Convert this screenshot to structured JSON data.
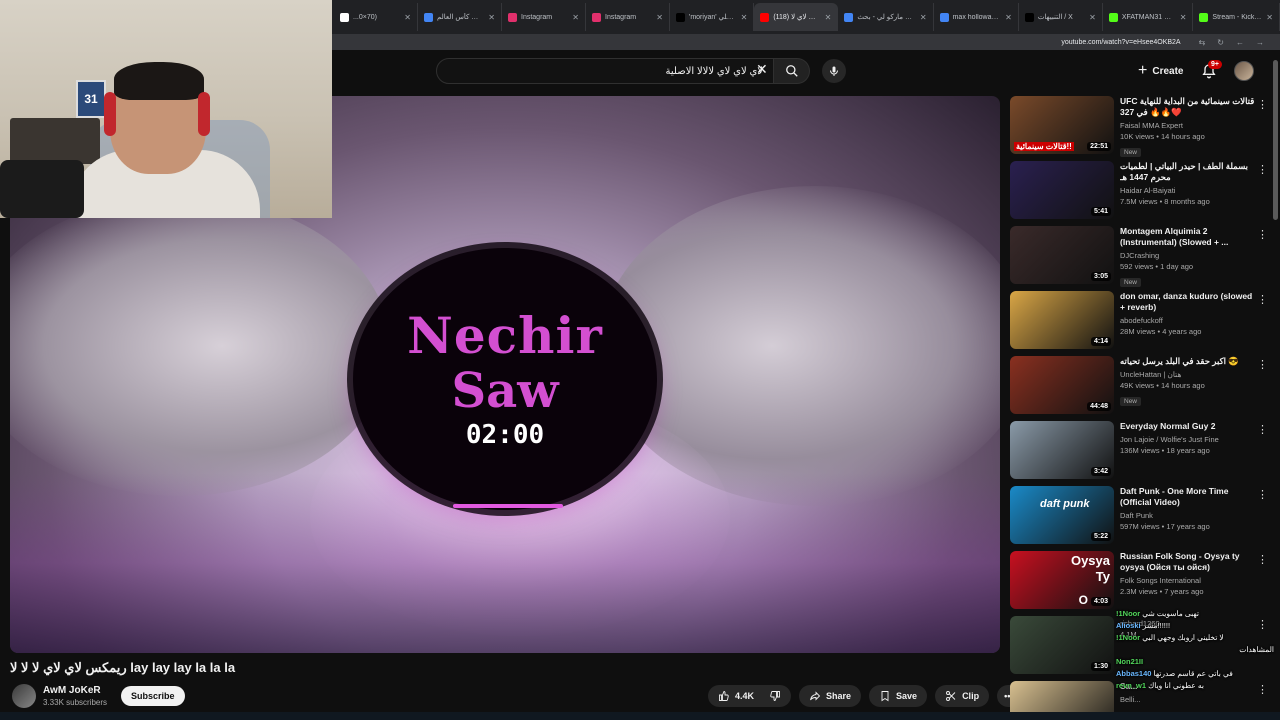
{
  "browser": {
    "tabs": [
      {
        "label": "...0×70)",
        "color": "#ffffff"
      },
      {
        "label": "مباريات كأس العالم",
        "color": "#4285f4"
      },
      {
        "label": "Instagram",
        "color": "#e1306c"
      },
      {
        "label": "Instagram",
        "color": "#e1306c"
      },
      {
        "label": "'moriyan' اخبار علي",
        "color": "#000000"
      },
      {
        "label": "(118) ريمكس لاي لا",
        "color": "#ff0000"
      },
      {
        "label": "ماركو لي - بحث Google",
        "color": "#4285f4"
      },
      {
        "label": "max holloway weig",
        "color": "#4285f4"
      },
      {
        "label": "التنبيهات / X",
        "color": "#000000"
      },
      {
        "label": "XFATMAN31 Stream",
        "color": "#53fc18"
      },
      {
        "label": "Stream - Kick Dash",
        "color": "#53fc18"
      }
    ],
    "url": "youtube.com/watch?v=eHsee4OKB2A"
  },
  "header": {
    "search_value": "لاي لاي لاي لالالا الاصلية",
    "create_label": "Create",
    "notif_badge": "9+"
  },
  "player": {
    "line1": "Nechir",
    "line2": "Saw",
    "time": "02:00"
  },
  "video": {
    "title": "ريمكس لاي لاي لا لا لا lay lay lay la la la",
    "channel": "AwM JoKeR",
    "subscribers": "3.33K subscribers",
    "subscribe_label": "Subscribe",
    "likes": "4.4K",
    "share_label": "Share",
    "save_label": "Save",
    "clip_label": "Clip"
  },
  "recommendations": [
    {
      "title": "UFC قتالات سينمائية من البداية للنهاية في 327 🔥🔥❤️",
      "channel": "Faisal MMA Expert",
      "meta": "10K views • 14 hours ago",
      "new": "New",
      "duration": "22:51",
      "thumb": "#7a4a2a"
    },
    {
      "title": "بسملة الطف | حيدر البياتي | لطميات محرم 1447 هـ",
      "channel": "Haidar Al-Baiyati",
      "meta": "7.5M views • 8 months ago",
      "new": "",
      "duration": "5:41",
      "thumb": "#2a2050"
    },
    {
      "title": "Montagem Alquimia 2 (Instrumental) (Slowed + ...",
      "channel": "DJCrashing",
      "meta": "592 views • 1 day ago",
      "new": "New",
      "duration": "3:05",
      "thumb": "#3a2a2a"
    },
    {
      "title": "don omar, danza kuduro (slowed + reverb)",
      "channel": "abodefuckoff",
      "meta": "28M views • 4 years ago",
      "new": "",
      "duration": "4:14",
      "thumb": "#d9a646"
    },
    {
      "title": "اكبر حقد في البلد يرسل تحياته 😎",
      "channel": "UncleHattan | هتان",
      "meta": "49K views • 14 hours ago",
      "new": "New",
      "duration": "44:48",
      "thumb": "#8a3020"
    },
    {
      "title": "Everyday Normal Guy 2",
      "channel": "Jon Lajoie / Wolfie's Just Fine",
      "meta": "136M views • 18 years ago",
      "new": "",
      "duration": "3:42",
      "thumb": "#8a9aa8"
    },
    {
      "title": "Daft Punk - One More Time (Official Video)",
      "channel": "Daft Punk",
      "meta": "597M views • 17 years ago",
      "new": "",
      "duration": "5:22",
      "thumb": "#1a8ac8"
    },
    {
      "title": "Russian Folk Song - Oysya ty oysya (Ойся ты ойся)",
      "channel": "Folk Songs International",
      "meta": "2.3M views • 7 years ago",
      "new": "",
      "duration": "4:03",
      "thumb": "#c81020"
    },
    {
      "title": "",
      "channel": "richard1260",
      "meta": "4.1M",
      "new": "",
      "duration": "1:30",
      "thumb": "#3a4a3a"
    },
    {
      "title": "Sa...",
      "channel": "Belli...",
      "meta": "",
      "new": "",
      "duration": "",
      "thumb": "#d8c090"
    }
  ],
  "thumb_texts": {
    "t1": "قتالات سينمائية!!",
    "t7": "daft punk",
    "t8a": "Oysya",
    "t8b": "Ty",
    "t8c": "O"
  },
  "webcam": {
    "poster": "31"
  },
  "chat": [
    {
      "user": "!1Noor",
      "msg": "تهبى ماسويت شي"
    },
    {
      "user": "Alioski",
      "msg": "مشر!!!!!!"
    },
    {
      "user": "!1Noor",
      "msg": "لا تخليني اروبك وجهي البي"
    },
    {
      "user": "",
      "msg": "المشاهدات"
    },
    {
      "user": "Non21II",
      "msg": ""
    },
    {
      "user": "Abbas140",
      "msg": "في باتي عم قاسم صدرتها"
    },
    {
      "user": "revn_w1",
      "msg": "به عطوني انا وياك"
    }
  ]
}
